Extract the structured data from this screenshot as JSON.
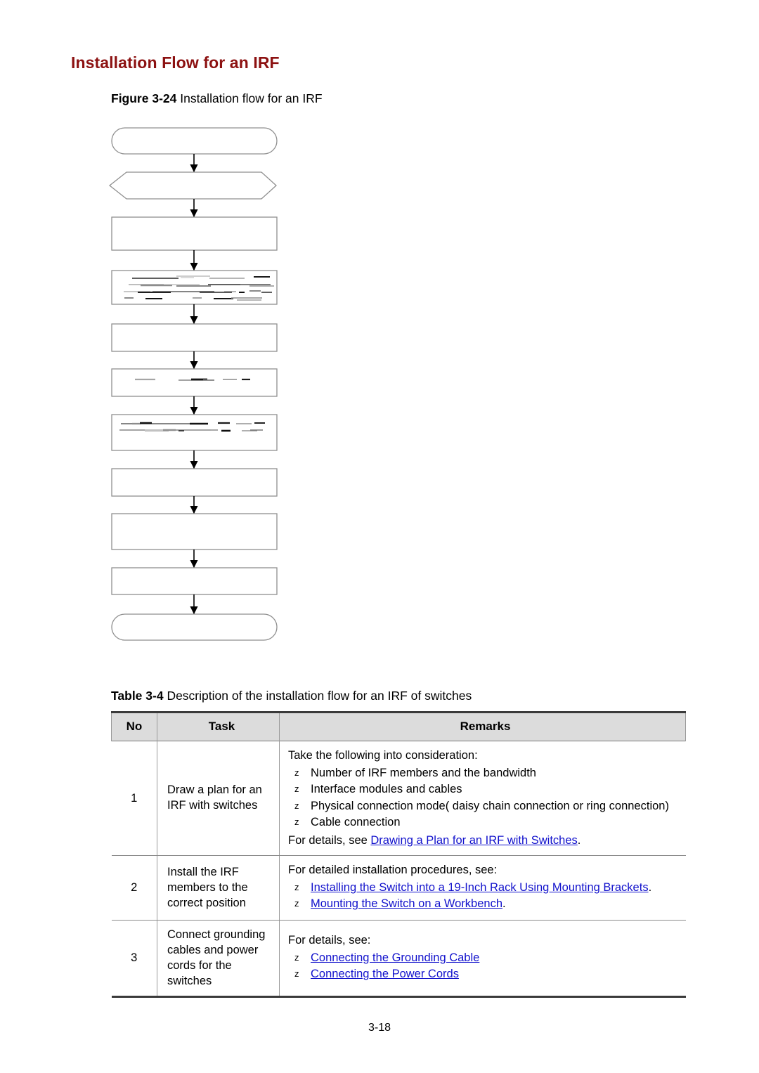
{
  "page": {
    "title": "Installation Flow for an IRF",
    "title_color": "#8c1111",
    "footer": "3-18"
  },
  "figure": {
    "caption_label": "Figure 3-24",
    "caption_text": " Installation flow for an IRF",
    "description": "Vertical flowchart: rounded start terminator, hexagon, eight process boxes, rounded end terminator, joined by downward arrows. Box label text is rendered as unreadable smudged marks in the source document.",
    "nodes": [
      {
        "id": "start",
        "shape": "terminator",
        "label": "",
        "text_rendered": "illegible"
      },
      {
        "id": "hexagon",
        "shape": "hexagon",
        "label": "",
        "text_rendered": "illegible"
      },
      {
        "id": "step1",
        "shape": "process",
        "label": "",
        "text_rendered": "illegible"
      },
      {
        "id": "step2",
        "shape": "process",
        "label": "",
        "text_rendered": "smudged"
      },
      {
        "id": "step3",
        "shape": "process",
        "label": "",
        "text_rendered": "illegible"
      },
      {
        "id": "step4",
        "shape": "process",
        "label": "",
        "text_rendered": "smudged"
      },
      {
        "id": "step5",
        "shape": "process",
        "label": "",
        "text_rendered": "smudged"
      },
      {
        "id": "step6",
        "shape": "process",
        "label": "",
        "text_rendered": "illegible"
      },
      {
        "id": "step7",
        "shape": "process",
        "label": "",
        "text_rendered": "illegible"
      },
      {
        "id": "step8",
        "shape": "process",
        "label": "",
        "text_rendered": "illegible"
      },
      {
        "id": "end",
        "shape": "terminator",
        "label": "",
        "text_rendered": "illegible"
      }
    ]
  },
  "table": {
    "caption_label": "Table 3-4",
    "caption_text": " Description of the installation flow for an IRF of switches",
    "header": {
      "no": "No",
      "task": "Task",
      "remarks": "Remarks"
    },
    "bullet_glyph": "z",
    "link_color": "#1111cc",
    "rows": [
      {
        "no": "1",
        "task": "Draw a plan for an IRF with switches",
        "lead": "Take the following into consideration:",
        "bullets": [
          {
            "text": "Number of IRF members and the bandwidth",
            "link": false
          },
          {
            "text": "Interface modules and cables",
            "link": false
          },
          {
            "text": "Physical connection mode( daisy chain connection or ring connection)",
            "link": false
          },
          {
            "text": "Cable connection",
            "link": false
          }
        ],
        "tail_prefix": "For details, see ",
        "tail_link": "Drawing a Plan for an IRF with Switches",
        "tail_suffix": "."
      },
      {
        "no": "2",
        "task": "Install the IRF members to the correct position",
        "lead": "For detailed installation procedures, see:",
        "bullets": [
          {
            "text": "Installing the Switch into a 19-Inch Rack Using Mounting Brackets",
            "link": true,
            "suffix": "."
          },
          {
            "text": "Mounting the Switch on a Workbench",
            "link": true,
            "suffix": "."
          }
        ],
        "tail_prefix": "",
        "tail_link": "",
        "tail_suffix": ""
      },
      {
        "no": "3",
        "task": "Connect grounding cables and power cords for the switches",
        "lead": "For details, see:",
        "bullets": [
          {
            "text": "Connecting the Grounding Cable",
            "link": true,
            "suffix": ""
          },
          {
            "text": "Connecting the Power Cords",
            "link": true,
            "suffix": ""
          }
        ],
        "tail_prefix": "",
        "tail_link": "",
        "tail_suffix": ""
      }
    ]
  }
}
